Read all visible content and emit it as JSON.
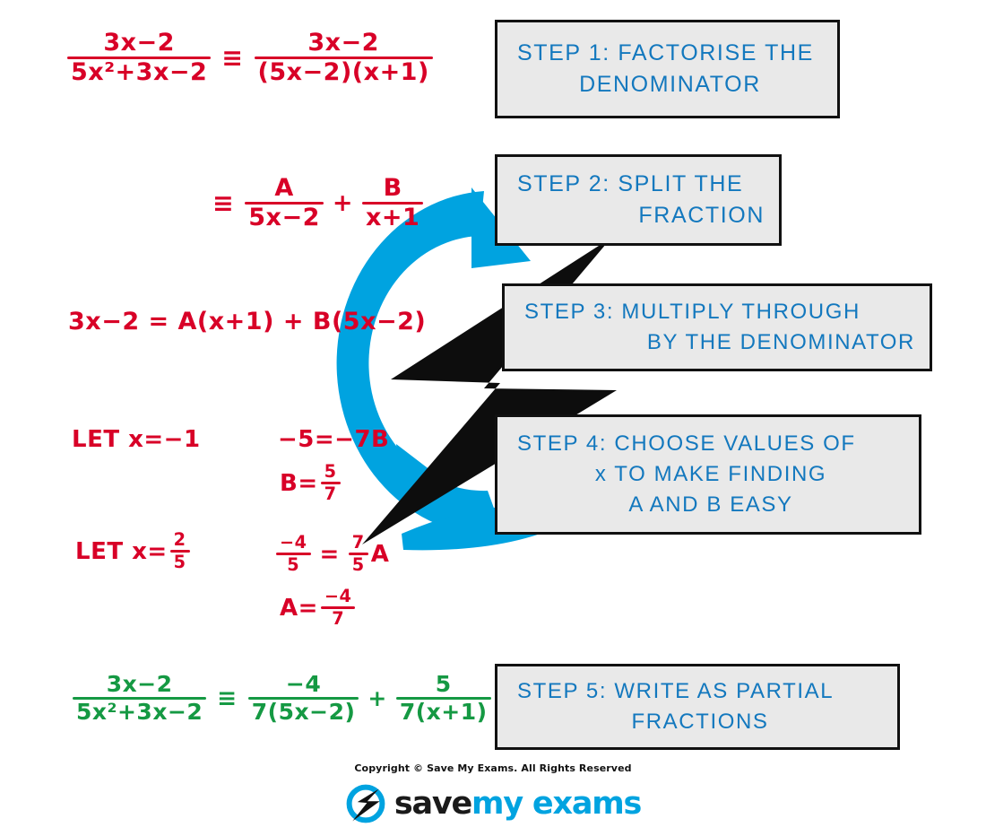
{
  "page": {
    "title": "Partial Fractions - Worked Example",
    "background_color": "#ffffff",
    "accent_blue": "#00A3E0",
    "text_blue": "#1378BE",
    "math_red": "#D80027",
    "math_green": "#159943",
    "box_fill": "#e9e9e9",
    "box_border": "#111111"
  },
  "steps": [
    {
      "id": "step-1",
      "line1": "STEP 1:  FACTORISE   THE",
      "line2": "DENOMINATOR"
    },
    {
      "id": "step-2",
      "line1": "STEP 2:  SPLIT   THE",
      "line2": "FRACTION"
    },
    {
      "id": "step-3",
      "line1": "STEP  3:  MULTIPLY   THROUGH",
      "line2": "BY  THE   DENOMINATOR"
    },
    {
      "id": "step-4",
      "line1": "STEP  4:  CHOOSE   VALUES  OF",
      "line2": "x  TO  MAKE  FINDING",
      "line3": "A  AND  B  EASY"
    },
    {
      "id": "step-5",
      "line1": "STEP 5:  WRITE   AS   PARTIAL",
      "line2": "FRACTIONS"
    }
  ],
  "math": {
    "eq1": {
      "lhs_num": "3x−2",
      "lhs_den": "5x²+3x−2",
      "equiv": "≡",
      "rhs_num": "3x−2",
      "rhs_den": "(5x−2)(x+1)"
    },
    "eq2": {
      "equiv": "≡",
      "t1_num": "A",
      "t1_den": "5x−2",
      "plus": "+",
      "t2_num": "B",
      "t2_den": "x+1"
    },
    "eq3": {
      "text": "3x−2 = A(x+1) + B(5x−2)"
    },
    "let_b": {
      "label": "LET  x=−1",
      "result": "−5=−7B",
      "value_lhs": "B=",
      "value_num": "5",
      "value_den": "7"
    },
    "let_a": {
      "label_lhs": "LET  x=",
      "label_num": "2",
      "label_den": "5",
      "result_num": "−4",
      "result_den": "5",
      "result_eq": "=",
      "result_num2": "7",
      "result_den2": "5",
      "result_tail": "A",
      "value_lhs": "A=",
      "value_num": "−4",
      "value_den": "7"
    },
    "answer": {
      "lhs_num": "3x−2",
      "lhs_den": "5x²+3x−2",
      "equiv": "≡",
      "t1_num": "−4",
      "t1_den": "7(5x−2)",
      "plus": "+",
      "t2_num": "5",
      "t2_den": "7(x+1)"
    }
  },
  "footer": {
    "copyright": "Copyright © Save My Exams. All Rights Reserved",
    "logo_word_1": "save",
    "logo_word_2": "my exams"
  }
}
